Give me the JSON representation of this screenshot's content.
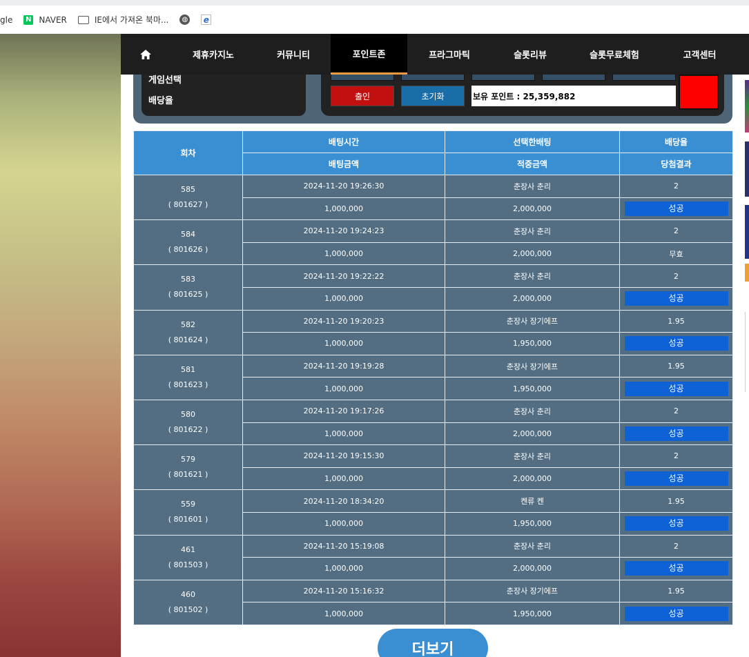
{
  "bookmarks": [
    {
      "label": "gle",
      "icon": "none"
    },
    {
      "label": "NAVER",
      "icon": "naver-icon"
    },
    {
      "label": "IE에서 가져온 북마...",
      "icon": "folder-icon"
    },
    {
      "label": "",
      "icon": "globe-icon"
    },
    {
      "label": "",
      "icon": "ie-icon"
    }
  ],
  "nav": {
    "home_icon": "home-icon",
    "items": [
      "제휴카지노",
      "커뮤니티",
      "포인트존",
      "프라그마틱",
      "슬롯리뷰",
      "슬롯무료체험",
      "고객센터"
    ],
    "active": "포인트존",
    "active_underline_color": "#f09a3e"
  },
  "panel": {
    "label_game": "게임선택",
    "label_odds": "배당율",
    "bet_button": "출인",
    "reset_button": "초기화",
    "points_text": "보유 포인트 : 25,359,882"
  },
  "table": {
    "headers": {
      "round": "회차",
      "bet_time": "배팅시간",
      "selected_bet": "선택한배팅",
      "odds": "배당율",
      "bet_amount": "배팅금액",
      "win_amount": "적중금액",
      "result": "당첨결과"
    },
    "rows": [
      {
        "round": "585",
        "round_id": "( 801627 )",
        "time": "2024-11-20 19:26:30",
        "selection": "춘장사 춘리",
        "odds": "2",
        "amount": "1,000,000",
        "win": "2,000,000",
        "result": "성공"
      },
      {
        "round": "584",
        "round_id": "( 801626 )",
        "time": "2024-11-20 19:24:23",
        "selection": "춘장사 춘리",
        "odds": "2",
        "amount": "1,000,000",
        "win": "2,000,000",
        "result": "무효"
      },
      {
        "round": "583",
        "round_id": "( 801625 )",
        "time": "2024-11-20 19:22:22",
        "selection": "춘장사 춘리",
        "odds": "2",
        "amount": "1,000,000",
        "win": "2,000,000",
        "result": "성공"
      },
      {
        "round": "582",
        "round_id": "( 801624 )",
        "time": "2024-11-20 19:20:23",
        "selection": "춘장사 장기에프",
        "odds": "1.95",
        "amount": "1,000,000",
        "win": "1,950,000",
        "result": "성공"
      },
      {
        "round": "581",
        "round_id": "( 801623 )",
        "time": "2024-11-20 19:19:28",
        "selection": "춘장사 장기에프",
        "odds": "1.95",
        "amount": "1,000,000",
        "win": "1,950,000",
        "result": "성공"
      },
      {
        "round": "580",
        "round_id": "( 801622 )",
        "time": "2024-11-20 19:17:26",
        "selection": "춘장사 춘리",
        "odds": "2",
        "amount": "1,000,000",
        "win": "2,000,000",
        "result": "성공"
      },
      {
        "round": "579",
        "round_id": "( 801621 )",
        "time": "2024-11-20 19:15:30",
        "selection": "춘장사 춘리",
        "odds": "2",
        "amount": "1,000,000",
        "win": "2,000,000",
        "result": "성공"
      },
      {
        "round": "559",
        "round_id": "( 801601 )",
        "time": "2024-11-20 18:34:20",
        "selection": "켄류 켄",
        "odds": "1.95",
        "amount": "1,000,000",
        "win": "1,950,000",
        "result": "성공"
      },
      {
        "round": "461",
        "round_id": "( 801503 )",
        "time": "2024-11-20 15:19:08",
        "selection": "춘장사 춘리",
        "odds": "2",
        "amount": "1,000,000",
        "win": "2,000,000",
        "result": "성공"
      },
      {
        "round": "460",
        "round_id": "( 801502 )",
        "time": "2024-11-20 15:16:32",
        "selection": "춘장사 장기에프",
        "odds": "1.95",
        "amount": "1,000,000",
        "win": "1,950,000",
        "result": "성공"
      }
    ],
    "success_badge_color": "#0e62d6"
  },
  "more_button": "더보기"
}
